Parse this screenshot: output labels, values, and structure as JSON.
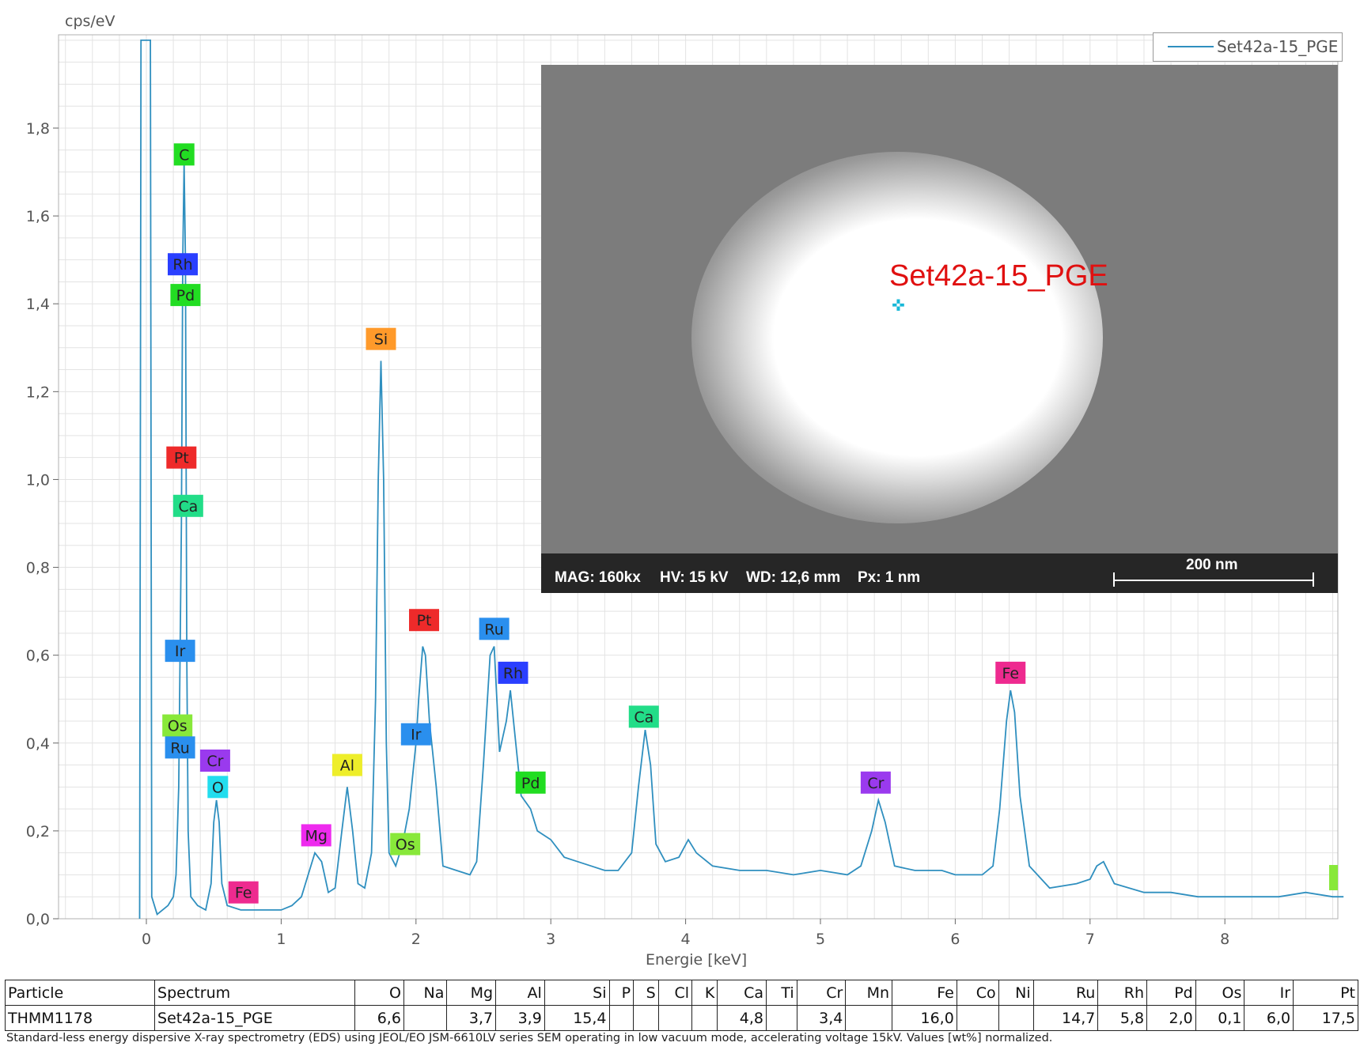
{
  "chart_data": {
    "type": "line",
    "ylabel": "cps/eV",
    "xlabel": "Energie [keV]",
    "xlim": [
      -0.6,
      8.9
    ],
    "ylim": [
      0,
      2.0
    ],
    "x_ticks": [
      "0",
      "1",
      "2",
      "3",
      "4",
      "5",
      "6",
      "7",
      "8"
    ],
    "y_ticks": [
      "0,0",
      "0,2",
      "0,4",
      "0,6",
      "0,8",
      "1,0",
      "1,2",
      "1,4",
      "1,6",
      "1,8"
    ],
    "grid": true,
    "legend_position": "top-right",
    "series": [
      {
        "name": "Set42a-15_PGE",
        "color": "#2f8fbf",
        "points": [
          [
            -0.05,
            0.0
          ],
          [
            -0.04,
            2.0
          ],
          [
            0.03,
            2.0
          ],
          [
            0.04,
            0.05
          ],
          [
            0.08,
            0.01
          ],
          [
            0.12,
            0.02
          ],
          [
            0.16,
            0.03
          ],
          [
            0.2,
            0.05
          ],
          [
            0.22,
            0.1
          ],
          [
            0.24,
            0.3
          ],
          [
            0.26,
            0.9
          ],
          [
            0.27,
            1.5
          ],
          [
            0.28,
            1.72
          ],
          [
            0.29,
            1.5
          ],
          [
            0.3,
            0.6
          ],
          [
            0.31,
            0.2
          ],
          [
            0.33,
            0.05
          ],
          [
            0.38,
            0.03
          ],
          [
            0.44,
            0.02
          ],
          [
            0.48,
            0.08
          ],
          [
            0.5,
            0.22
          ],
          [
            0.52,
            0.27
          ],
          [
            0.54,
            0.22
          ],
          [
            0.56,
            0.08
          ],
          [
            0.6,
            0.03
          ],
          [
            0.7,
            0.02
          ],
          [
            0.8,
            0.02
          ],
          [
            0.9,
            0.02
          ],
          [
            1.0,
            0.02
          ],
          [
            1.08,
            0.03
          ],
          [
            1.15,
            0.05
          ],
          [
            1.2,
            0.1
          ],
          [
            1.25,
            0.15
          ],
          [
            1.3,
            0.13
          ],
          [
            1.35,
            0.06
          ],
          [
            1.4,
            0.07
          ],
          [
            1.45,
            0.2
          ],
          [
            1.49,
            0.3
          ],
          [
            1.53,
            0.2
          ],
          [
            1.57,
            0.08
          ],
          [
            1.62,
            0.07
          ],
          [
            1.67,
            0.15
          ],
          [
            1.7,
            0.5
          ],
          [
            1.72,
            1.0
          ],
          [
            1.74,
            1.27
          ],
          [
            1.76,
            1.0
          ],
          [
            1.78,
            0.4
          ],
          [
            1.8,
            0.15
          ],
          [
            1.85,
            0.12
          ],
          [
            1.9,
            0.17
          ],
          [
            1.95,
            0.25
          ],
          [
            2.0,
            0.4
          ],
          [
            2.02,
            0.5
          ],
          [
            2.05,
            0.62
          ],
          [
            2.07,
            0.6
          ],
          [
            2.1,
            0.45
          ],
          [
            2.15,
            0.3
          ],
          [
            2.2,
            0.12
          ],
          [
            2.3,
            0.11
          ],
          [
            2.4,
            0.1
          ],
          [
            2.45,
            0.13
          ],
          [
            2.5,
            0.35
          ],
          [
            2.55,
            0.6
          ],
          [
            2.58,
            0.62
          ],
          [
            2.62,
            0.38
          ],
          [
            2.67,
            0.45
          ],
          [
            2.7,
            0.52
          ],
          [
            2.74,
            0.4
          ],
          [
            2.78,
            0.28
          ],
          [
            2.85,
            0.25
          ],
          [
            2.9,
            0.2
          ],
          [
            3.0,
            0.18
          ],
          [
            3.1,
            0.14
          ],
          [
            3.2,
            0.13
          ],
          [
            3.3,
            0.12
          ],
          [
            3.4,
            0.11
          ],
          [
            3.5,
            0.11
          ],
          [
            3.6,
            0.15
          ],
          [
            3.65,
            0.3
          ],
          [
            3.7,
            0.43
          ],
          [
            3.74,
            0.35
          ],
          [
            3.78,
            0.17
          ],
          [
            3.85,
            0.13
          ],
          [
            3.95,
            0.14
          ],
          [
            4.02,
            0.18
          ],
          [
            4.08,
            0.15
          ],
          [
            4.2,
            0.12
          ],
          [
            4.4,
            0.11
          ],
          [
            4.6,
            0.11
          ],
          [
            4.8,
            0.1
          ],
          [
            5.0,
            0.11
          ],
          [
            5.2,
            0.1
          ],
          [
            5.3,
            0.12
          ],
          [
            5.38,
            0.2
          ],
          [
            5.43,
            0.27
          ],
          [
            5.48,
            0.22
          ],
          [
            5.55,
            0.12
          ],
          [
            5.7,
            0.11
          ],
          [
            5.9,
            0.11
          ],
          [
            6.0,
            0.1
          ],
          [
            6.1,
            0.1
          ],
          [
            6.2,
            0.1
          ],
          [
            6.28,
            0.12
          ],
          [
            6.33,
            0.25
          ],
          [
            6.38,
            0.45
          ],
          [
            6.41,
            0.52
          ],
          [
            6.44,
            0.47
          ],
          [
            6.48,
            0.28
          ],
          [
            6.55,
            0.12
          ],
          [
            6.7,
            0.07
          ],
          [
            6.9,
            0.08
          ],
          [
            7.0,
            0.09
          ],
          [
            7.05,
            0.12
          ],
          [
            7.1,
            0.13
          ],
          [
            7.18,
            0.08
          ],
          [
            7.4,
            0.06
          ],
          [
            7.6,
            0.06
          ],
          [
            7.8,
            0.05
          ],
          [
            8.0,
            0.05
          ],
          [
            8.2,
            0.05
          ],
          [
            8.4,
            0.05
          ],
          [
            8.6,
            0.06
          ],
          [
            8.8,
            0.05
          ],
          [
            8.88,
            0.05
          ]
        ]
      }
    ],
    "peak_labels": [
      {
        "text": "C",
        "x": 0.28,
        "y": 1.74,
        "color": "#22dd22"
      },
      {
        "text": "Rh",
        "x": 0.27,
        "y": 1.49,
        "color": "#2a3fff"
      },
      {
        "text": "Pd",
        "x": 0.29,
        "y": 1.42,
        "color": "#22dd22"
      },
      {
        "text": "Pt",
        "x": 0.26,
        "y": 1.05,
        "color": "#ee2a2a"
      },
      {
        "text": "Ca",
        "x": 0.31,
        "y": 0.94,
        "color": "#22dd88"
      },
      {
        "text": "Ir",
        "x": 0.25,
        "y": 0.61,
        "color": "#2a8fee"
      },
      {
        "text": "Os",
        "x": 0.23,
        "y": 0.44,
        "color": "#88e83a"
      },
      {
        "text": "Ru",
        "x": 0.25,
        "y": 0.39,
        "color": "#2a8fee"
      },
      {
        "text": "Cr",
        "x": 0.51,
        "y": 0.36,
        "color": "#9a3aee"
      },
      {
        "text": "O",
        "x": 0.53,
        "y": 0.3,
        "color": "#22ddee"
      },
      {
        "text": "Fe",
        "x": 0.72,
        "y": 0.06,
        "color": "#ee2a8f"
      },
      {
        "text": "Mg",
        "x": 1.26,
        "y": 0.19,
        "color": "#ee2aee"
      },
      {
        "text": "Al",
        "x": 1.49,
        "y": 0.35,
        "color": "#eeee2a"
      },
      {
        "text": "Si",
        "x": 1.74,
        "y": 1.32,
        "color": "#ff9a2a"
      },
      {
        "text": "Os",
        "x": 1.92,
        "y": 0.17,
        "color": "#88e83a"
      },
      {
        "text": "Ir",
        "x": 2.0,
        "y": 0.42,
        "color": "#2a8fee"
      },
      {
        "text": "Pt",
        "x": 2.06,
        "y": 0.68,
        "color": "#ee2a2a"
      },
      {
        "text": "Ru",
        "x": 2.58,
        "y": 0.66,
        "color": "#2a8fee"
      },
      {
        "text": "Rh",
        "x": 2.72,
        "y": 0.56,
        "color": "#2a3fff"
      },
      {
        "text": "Pd",
        "x": 2.85,
        "y": 0.31,
        "color": "#22dd22"
      },
      {
        "text": "Ca",
        "x": 3.69,
        "y": 0.46,
        "color": "#22dd88"
      },
      {
        "text": "Cr",
        "x": 5.41,
        "y": 0.31,
        "color": "#9a3aee"
      },
      {
        "text": "Fe",
        "x": 6.41,
        "y": 0.56,
        "color": "#ee2a8f"
      }
    ]
  },
  "inset": {
    "specimen_label": "Set42a-15_PGE",
    "info": {
      "mag": "MAG: 160kx",
      "hv": "HV: 15 kV",
      "wd": "WD: 12,6 mm",
      "px": "Px: 1 nm"
    },
    "scale": "200 nm"
  },
  "table": {
    "headers": [
      "Particle",
      "Spectrum",
      "O",
      "Na",
      "Mg",
      "Al",
      "Si",
      "P",
      "S",
      "Cl",
      "K",
      "Ca",
      "Ti",
      "Cr",
      "Mn",
      "Fe",
      "Co",
      "Ni",
      "Ru",
      "Rh",
      "Pd",
      "Os",
      "Ir",
      "Pt"
    ],
    "row": [
      "THMM1178",
      "Set42a-15_PGE",
      "6,6",
      "",
      "3,7",
      "3,9",
      "15,4",
      "",
      "",
      "",
      "",
      "4,8",
      "",
      "3,4",
      "",
      "16,0",
      "",
      "",
      "14,7",
      "5,8",
      "2,0",
      "0,1",
      "6,0",
      "17,5"
    ]
  },
  "footnote": "Standard-less energy dispersive X-ray spectrometry (EDS) using JEOL/EO JSM-6610LV series SEM operating in low vacuum mode, accelerating voltage 15kV. Values [wt%] normalized.",
  "colors": {
    "series": "#2f8fbf",
    "grid": "#e3e3e3",
    "spec_label": "#e01010"
  }
}
